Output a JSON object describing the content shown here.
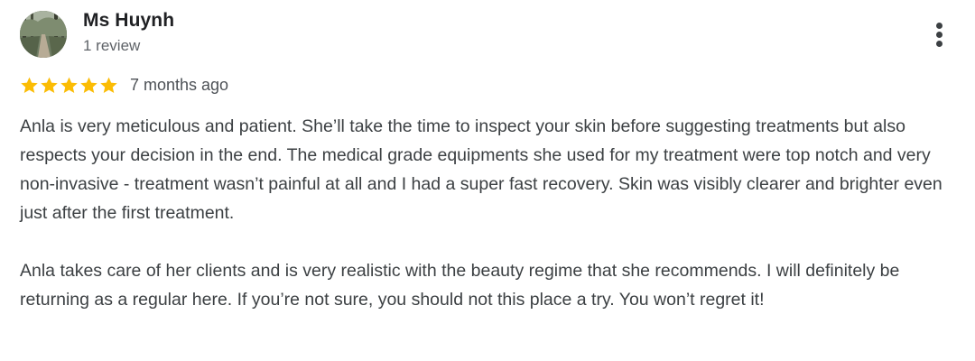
{
  "reviewer": {
    "name": "Ms Huynh",
    "review_count": "1 review",
    "avatar_icon": "forest-path-photo"
  },
  "review": {
    "rating": 5,
    "max_rating": 5,
    "date": "7 months ago",
    "paragraphs": [
      "Anla is very meticulous and patient. She’ll take the time to inspect your skin before suggesting treatments but also respects your decision in the end. The medical grade equipments she used for my treatment were top notch and very non-invasive - treatment wasn’t painful at all and I had a super fast recovery. Skin was visibly clearer and brighter even just after the first treatment.",
      "Anla takes care of her clients and is very realistic with the beauty regime that she recommends. I will definitely be returning as a regular here. If you’re not sure, you should not this place a try. You won’t regret it!"
    ]
  },
  "menu": {
    "icon": "more-vertical-icon"
  },
  "colors": {
    "star": "#fbbc04",
    "name": "#202124",
    "text": "#3c4043",
    "secondary": "#5f6368"
  }
}
